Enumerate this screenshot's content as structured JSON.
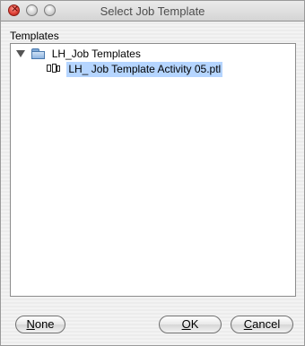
{
  "window": {
    "title": "Select Job Template",
    "controls": [
      "close",
      "minimize",
      "zoom"
    ]
  },
  "section_label": "Templates",
  "tree": {
    "root": {
      "label": "LH_Job Templates",
      "icon": "folder-icon",
      "expanded": true,
      "children": [
        {
          "label": "LH_ Job Template Activity 05.ptl",
          "icon": "template-icon",
          "selected": true
        }
      ]
    }
  },
  "buttons": {
    "none": {
      "label": "None",
      "mnemonic": "N",
      "rest": "one"
    },
    "ok": {
      "label": "OK",
      "mnemonic": "O",
      "rest": "K"
    },
    "cancel": {
      "label": "Cancel",
      "mnemonic": "C",
      "rest": "ancel"
    }
  },
  "colors": {
    "selection": "#b5d5ff",
    "close_button": "#e0443a"
  }
}
